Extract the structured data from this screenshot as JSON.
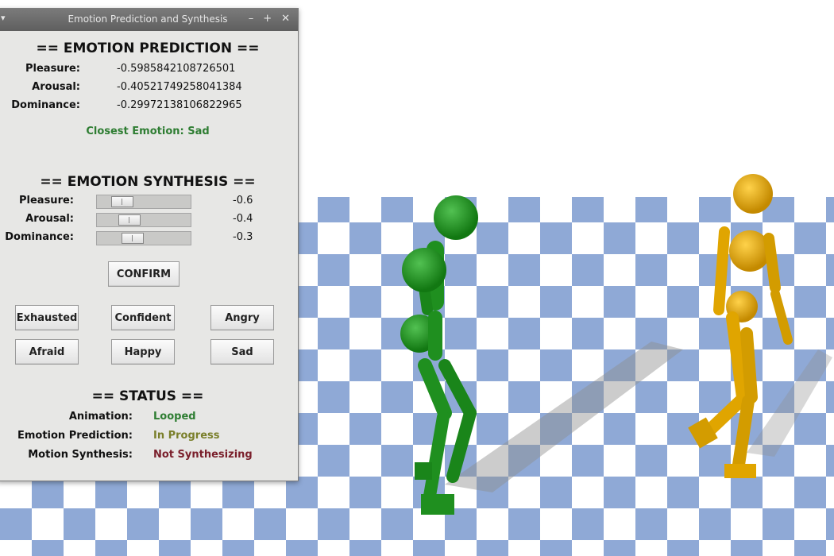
{
  "window": {
    "title": "Emotion Prediction and Synthesis"
  },
  "prediction": {
    "header": "== EMOTION PREDICTION ==",
    "rows": [
      {
        "label": "Pleasure:",
        "value": "-0.5985842108726501"
      },
      {
        "label": "Arousal:",
        "value": "-0.40521749258041384"
      },
      {
        "label": "Dominance:",
        "value": "-0.29972138106822965"
      }
    ],
    "closest": "Closest Emotion: Sad"
  },
  "synthesis": {
    "header": "== EMOTION SYNTHESIS ==",
    "sliders": [
      {
        "label": "Pleasure:",
        "value": "-0.6",
        "level": 0.2
      },
      {
        "label": "Arousal:",
        "value": "-0.4",
        "level": 0.3
      },
      {
        "label": "Dominance:",
        "value": "-0.3",
        "level": 0.35
      }
    ],
    "confirm": "CONFIRM",
    "emotions": [
      "Exhausted",
      "Confident",
      "Angry",
      "Afraid",
      "Happy",
      "Sad"
    ]
  },
  "status": {
    "header": "== STATUS ==",
    "rows": [
      {
        "label": "Animation:",
        "value": "Looped",
        "color": "#2e7d32"
      },
      {
        "label": "Emotion Prediction:",
        "value": "In Progress",
        "color": "#7a7f2a"
      },
      {
        "label": "Motion Synthesis:",
        "value": "Not Synthesizing",
        "color": "#7a1f2b"
      }
    ]
  },
  "colors": {
    "figure_green": "#1f8f1f",
    "figure_yellow": "#e0a500",
    "floor_blue": "#8fa9d6"
  }
}
